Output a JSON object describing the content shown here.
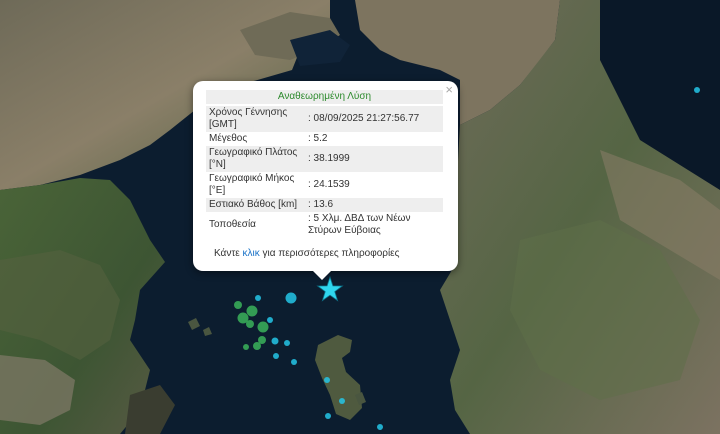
{
  "popup": {
    "title": "Αναθεωρημένη Λύση",
    "close_symbol": "×",
    "rows": [
      {
        "label": "Χρόνος Γέννησης [GMT]",
        "value": ": 08/09/2025 21:27:56.77"
      },
      {
        "label": "Μέγεθος",
        "value": ": 5.2"
      },
      {
        "label": "Γεωγραφικό Πλάτος [°N]",
        "value": ": 38.1999"
      },
      {
        "label": "Γεωγραφικό Μήκος [°E]",
        "value": ": 24.1539"
      },
      {
        "label": "Εστιακό Βάθος [km]",
        "value": ": 13.6"
      },
      {
        "label": "Τοποθεσία",
        "value": ": 5 Χλμ. ΔΒΔ των Νέων Στύρων Εύβοιας"
      }
    ],
    "more_before": "Κάντε",
    "more_link": "κλικ",
    "more_after": "για περισσότερες πληροφορίες"
  },
  "colors": {
    "sea": "#0c1d2f",
    "land_green": "#3f5a34",
    "land_brown": "#7a6f5b",
    "marker_cyan": "#25c5e6",
    "marker_green": "#3bb35a",
    "star": "#2fd6ee"
  },
  "icons": {
    "main_event": "star-icon",
    "events": "circle-marker-icon"
  }
}
